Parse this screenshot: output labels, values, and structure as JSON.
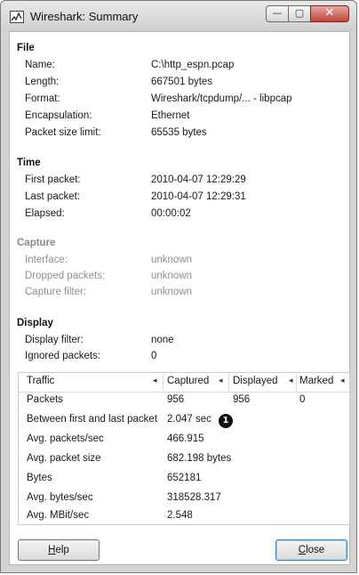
{
  "window": {
    "title": "Wireshark: Summary",
    "buttons": {
      "minimize": "—",
      "maximize": "▢",
      "close": "✕"
    }
  },
  "file": {
    "title": "File",
    "rows": [
      {
        "label": "Name:",
        "value": "C:\\http_espn.pcap"
      },
      {
        "label": "Length:",
        "value": "667501 bytes"
      },
      {
        "label": "Format:",
        "value": "Wireshark/tcpdump/... - libpcap"
      },
      {
        "label": "Encapsulation:",
        "value": "Ethernet"
      },
      {
        "label": "Packet size limit:",
        "value": "65535 bytes"
      }
    ]
  },
  "time": {
    "title": "Time",
    "rows": [
      {
        "label": "First packet:",
        "value": "2010-04-07 12:29:29"
      },
      {
        "label": "Last packet:",
        "value": "2010-04-07 12:29:31"
      },
      {
        "label": "Elapsed:",
        "value": "00:00:02"
      }
    ]
  },
  "capture": {
    "title": "Capture",
    "rows": [
      {
        "label": "Interface:",
        "value": "unknown"
      },
      {
        "label": "Dropped packets:",
        "value": "unknown"
      },
      {
        "label": "Capture filter:",
        "value": "unknown"
      }
    ]
  },
  "display": {
    "title": "Display",
    "rows": [
      {
        "label": "Display filter:",
        "value": "none"
      },
      {
        "label": "Ignored packets:",
        "value": "0"
      }
    ]
  },
  "traffic": {
    "headers": [
      "Traffic",
      "Captured",
      "Displayed",
      "Marked"
    ],
    "rows": [
      [
        "Packets",
        "956",
        "956",
        "0"
      ],
      [
        "Between first and last packet",
        "2.047 sec",
        "",
        ""
      ],
      [
        "Avg. packets/sec",
        "466.915",
        "",
        ""
      ],
      [
        "Avg. packet size",
        "682.198 bytes",
        "",
        ""
      ],
      [
        "Bytes",
        "652181",
        "",
        ""
      ],
      [
        "Avg. bytes/sec",
        "318528.317",
        "",
        ""
      ],
      [
        "Avg. MBit/sec",
        "2.548",
        "",
        ""
      ]
    ],
    "callout": "1"
  },
  "footer": {
    "help_prefix": "",
    "help_mnemonic": "H",
    "help_rest": "elp",
    "close_mnemonic": "C",
    "close_rest": "lose"
  }
}
